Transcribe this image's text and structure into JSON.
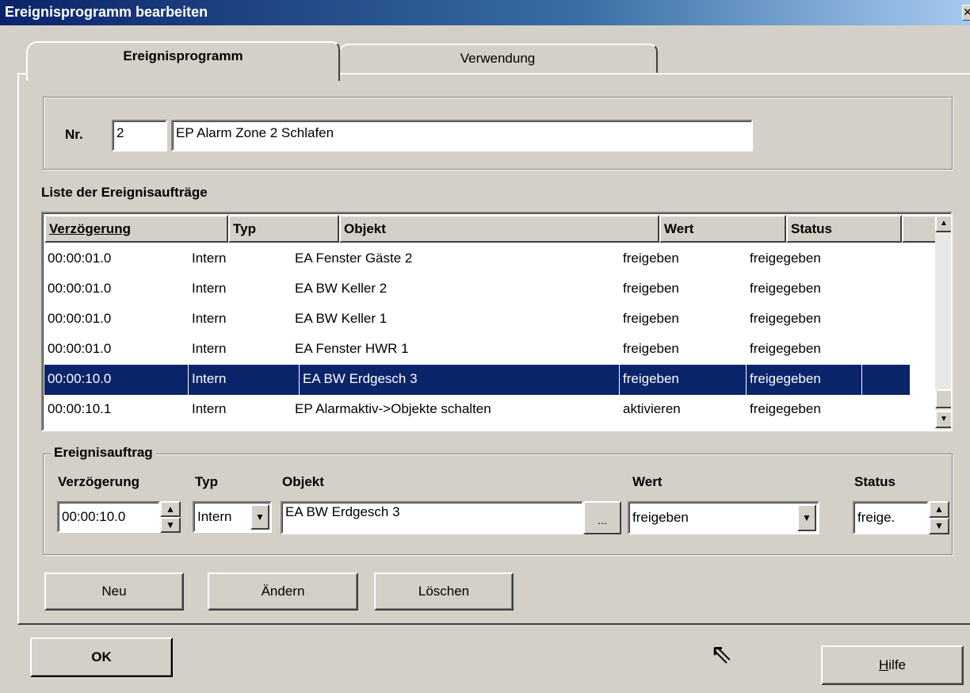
{
  "window": {
    "title": "Ereignisprogramm bearbeiten",
    "close_symbol": "✕"
  },
  "tabs": [
    {
      "label": "Ereignisprogramm",
      "active": true
    },
    {
      "label": "Verwendung",
      "active": false
    }
  ],
  "program": {
    "nr_label": "Nr.",
    "nr_value": "2",
    "name_value": "EP Alarm Zone 2 Schlafen"
  },
  "list": {
    "label": "Liste der Ereignisaufträge",
    "columns": [
      "Verzögerung",
      "Typ",
      "Objekt",
      "Wert",
      "Status"
    ],
    "rows": [
      {
        "delay": "00:00:01.0",
        "type": "Intern",
        "object": "EA Fenster Gäste 2",
        "value": "freigeben",
        "status": "freigegeben"
      },
      {
        "delay": "00:00:01.0",
        "type": "Intern",
        "object": "EA BW Keller 2",
        "value": "freigeben",
        "status": "freigegeben"
      },
      {
        "delay": "00:00:01.0",
        "type": "Intern",
        "object": "EA BW Keller 1",
        "value": "freigeben",
        "status": "freigegeben"
      },
      {
        "delay": "00:00:01.0",
        "type": "Intern",
        "object": "EA Fenster HWR 1",
        "value": "freigeben",
        "status": "freigegeben"
      },
      {
        "delay": "00:00:10.0",
        "type": "Intern",
        "object": "EA BW Erdgesch 3",
        "value": "freigeben",
        "status": "freigegeben",
        "selected": true
      },
      {
        "delay": "00:00:10.1",
        "type": "Intern",
        "object": "EP Alarmaktiv->Objekte schalten",
        "value": "aktivieren",
        "status": "freigegeben"
      }
    ]
  },
  "order": {
    "legend": "Ereignisauftrag",
    "labels": {
      "delay": "Verzögerung",
      "type": "Typ",
      "object": "Objekt",
      "value": "Wert",
      "status": "Status"
    },
    "values": {
      "delay": "00:00:10.0",
      "type": "Intern",
      "object": "EA BW Erdgesch 3",
      "value": "freigeben",
      "status": "freige."
    },
    "browse_label": "..."
  },
  "buttons": {
    "new": "Neu",
    "change": "Ändern",
    "delete": "Löschen",
    "ok": "OK",
    "help_first": "H",
    "help_rest": "ilfe"
  },
  "icons": {
    "spin_up": "▲",
    "spin_down": "▼",
    "dropdown": "▼",
    "scroll_up": "▲",
    "scroll_down": "▼",
    "cursor": "⇖"
  }
}
